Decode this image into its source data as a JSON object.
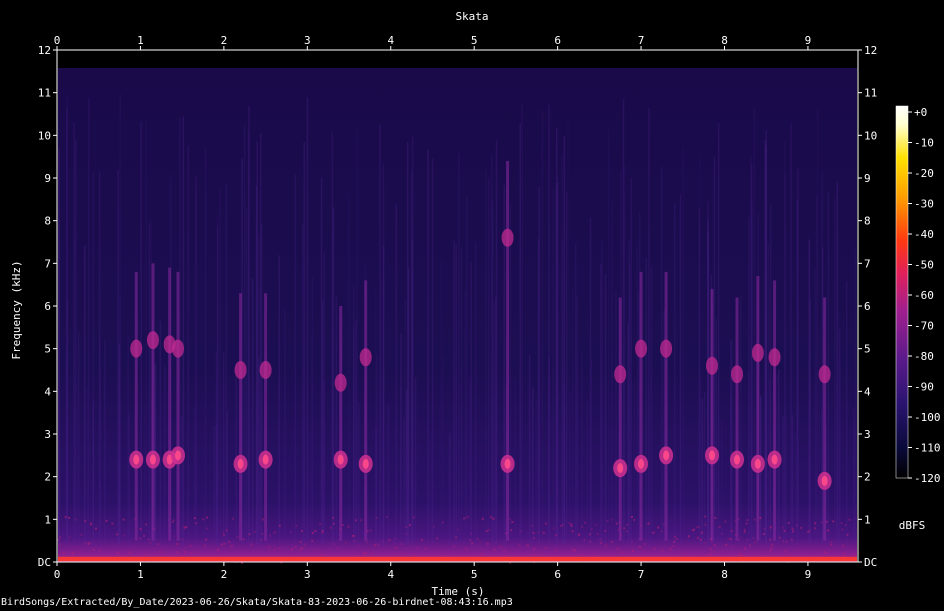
{
  "chart_data": {
    "type": "heatmap",
    "title": "Skata",
    "xlabel": "Time (s)",
    "ylabel": "Frequency (kHz)",
    "xlim": [
      0,
      9.6
    ],
    "ylim": [
      0,
      12
    ],
    "x_ticks": [
      "0",
      "1",
      "2",
      "3",
      "4",
      "5",
      "6",
      "7",
      "8",
      "9"
    ],
    "y_ticks": [
      "DC",
      "1",
      "2",
      "3",
      "4",
      "5",
      "6",
      "7",
      "8",
      "9",
      "10",
      "11",
      "12"
    ],
    "colorbar": {
      "unit": "dBFS",
      "range": [
        -120,
        0
      ],
      "ticks": [
        "+0",
        "-10",
        "-20",
        "-30",
        "-40",
        "-50",
        "-60",
        "-70",
        "-80",
        "-90",
        "-100",
        "-110",
        "-120"
      ]
    },
    "colormap": [
      "#000000",
      "#0a0a3a",
      "#2a1470",
      "#5a1a8a",
      "#a01f8f",
      "#e0205a",
      "#ff3a10",
      "#ff9a00",
      "#ffe000",
      "#ffffd0",
      "#ffffff"
    ],
    "events": [
      {
        "t": 0.95,
        "f_low": 2.4,
        "f_high": 5.0
      },
      {
        "t": 1.15,
        "f_low": 2.4,
        "f_high": 5.2
      },
      {
        "t": 1.35,
        "f_low": 2.4,
        "f_high": 5.1
      },
      {
        "t": 1.45,
        "f_low": 2.5,
        "f_high": 5.0
      },
      {
        "t": 2.2,
        "f_low": 2.3,
        "f_high": 4.5
      },
      {
        "t": 2.5,
        "f_low": 2.4,
        "f_high": 4.5
      },
      {
        "t": 3.4,
        "f_low": 2.4,
        "f_high": 4.2
      },
      {
        "t": 3.7,
        "f_low": 2.3,
        "f_high": 4.8
      },
      {
        "t": 5.4,
        "f_low": 2.3,
        "f_high": 7.6
      },
      {
        "t": 6.75,
        "f_low": 2.2,
        "f_high": 4.4
      },
      {
        "t": 7.0,
        "f_low": 2.3,
        "f_high": 5.0
      },
      {
        "t": 7.3,
        "f_low": 2.5,
        "f_high": 5.0
      },
      {
        "t": 7.85,
        "f_low": 2.5,
        "f_high": 4.6
      },
      {
        "t": 8.15,
        "f_low": 2.4,
        "f_high": 4.4
      },
      {
        "t": 8.4,
        "f_low": 2.3,
        "f_high": 4.9
      },
      {
        "t": 8.6,
        "f_low": 2.4,
        "f_high": 4.8
      },
      {
        "t": 9.2,
        "f_low": 1.9,
        "f_high": 4.4
      }
    ]
  },
  "footer": {
    "path": "BirdSongs/Extracted/By_Date/2023-06-26/Skata/Skata-83-2023-06-26-birdnet-08:43:16.mp3"
  }
}
